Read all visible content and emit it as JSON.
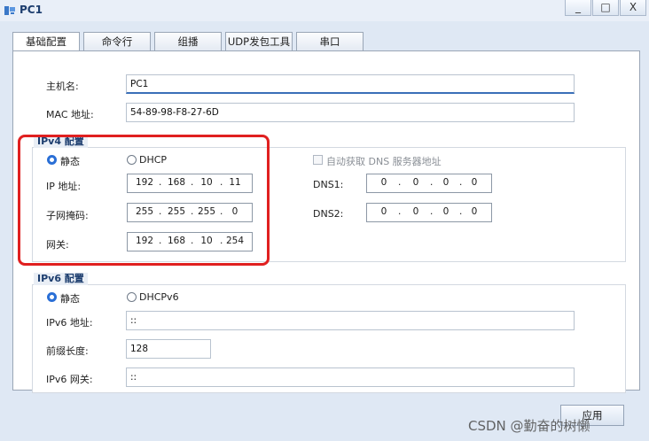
{
  "window": {
    "title": "PC1",
    "minimize": "_",
    "maximize": "□",
    "close": "X"
  },
  "tabs": [
    "基础配置",
    "命令行",
    "组播",
    "UDP发包工具",
    "串口"
  ],
  "basic": {
    "hostname_label": "主机名:",
    "hostname_value": "PC1",
    "mac_label": "MAC 地址:",
    "mac_value": "54-89-98-F8-27-6D"
  },
  "ipv4": {
    "title": "IPv4 配置",
    "static_label": "静态",
    "dhcp_label": "DHCP",
    "auto_dns_label": "自动获取 DNS 服务器地址",
    "ip_label": "IP 地址:",
    "ip": [
      "192",
      "168",
      "10",
      "11"
    ],
    "mask_label": "子网掩码:",
    "mask": [
      "255",
      "255",
      "255",
      "0"
    ],
    "gateway_label": "网关:",
    "gateway": [
      "192",
      "168",
      "10",
      "254"
    ],
    "dns1_label": "DNS1:",
    "dns1": [
      "0",
      "0",
      "0",
      "0"
    ],
    "dns2_label": "DNS2:",
    "dns2": [
      "0",
      "0",
      "0",
      "0"
    ]
  },
  "ipv6": {
    "title": "IPv6 配置",
    "static_label": "静态",
    "dhcp_label": "DHCPv6",
    "addr_label": "IPv6 地址:",
    "addr_value": "::",
    "prefix_label": "前缀长度:",
    "prefix_value": "128",
    "gateway_label": "IPv6 网关:",
    "gateway_value": "::"
  },
  "apply_label": "应用",
  "watermark": "CSDN @勤奋的树懒"
}
